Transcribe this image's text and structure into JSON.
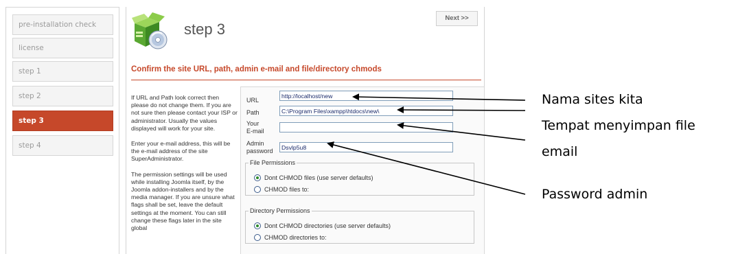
{
  "sidebar": {
    "items": [
      {
        "label": "pre-installation check",
        "active": false
      },
      {
        "label": "license",
        "active": false
      },
      {
        "label": "step 1",
        "active": false
      },
      {
        "label": "step 2",
        "active": false
      },
      {
        "label": "step 3",
        "active": true
      },
      {
        "label": "step 4",
        "active": false
      }
    ]
  },
  "header": {
    "title": "step 3",
    "icon": "install-box-cd-icon",
    "next_label": "Next >>"
  },
  "section": {
    "title": "Confirm the site URL, path, admin e-mail and file/directory chmods"
  },
  "help": {
    "paragraphs": [
      "If URL and Path look correct then please do not change them. If you are not sure then please contact your ISP or administrator. Usually the values displayed will work for your site.",
      "Enter your e-mail address, this will be the e-mail address of the site SuperAdministrator.",
      "The permission settings will be used while installing Joomla itself, by the Joomla addon-installers and by the media manager. If you are unsure what flags shall be set, leave the default settings at the moment. You can still change these flags later in the site global"
    ]
  },
  "form": {
    "url": {
      "label": "URL",
      "value": "http://localhost/new"
    },
    "path": {
      "label": "Path",
      "value": "C:\\Program Files\\xampp\\htdocs\\new\\"
    },
    "email": {
      "label_line1": "Your",
      "label_line2": "E-mail",
      "value": ""
    },
    "password": {
      "label_line1": "Admin",
      "label_line2": "password",
      "value": "Dsvlp5u8"
    },
    "file_permissions": {
      "legend": "File Permissions",
      "options": [
        "Dont CHMOD files (use server defaults)",
        "CHMOD files to:"
      ],
      "selected": 0
    },
    "dir_permissions": {
      "legend": "Directory Permissions",
      "options": [
        "Dont CHMOD directories (use server defaults)",
        "CHMOD directories to:"
      ],
      "selected": 0
    }
  },
  "annotations": [
    "Nama sites kita",
    "Tempat menyimpan file",
    "email",
    "Password admin"
  ],
  "colors": {
    "accent": "#c6482a",
    "field_text": "#1a2a6a"
  }
}
